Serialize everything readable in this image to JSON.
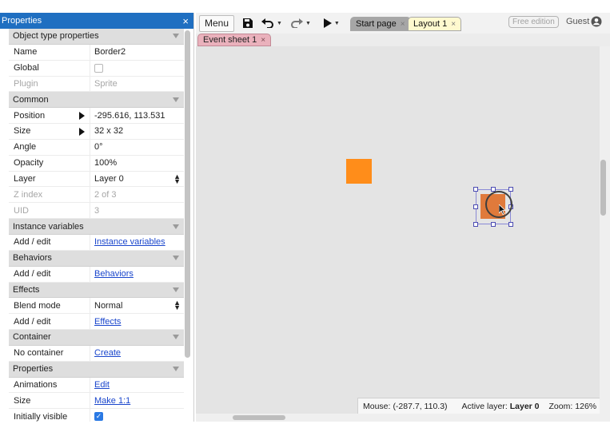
{
  "panel": {
    "title": "Properties",
    "close_glyph": "×",
    "rows": [
      {
        "type": "section",
        "label": "Object type properties"
      },
      {
        "type": "text",
        "label": "Name",
        "value": "Border2"
      },
      {
        "type": "checkbox",
        "label": "Global",
        "checked": false
      },
      {
        "type": "text",
        "label": "Plugin",
        "value": "Sprite",
        "dim": true
      },
      {
        "type": "section",
        "label": "Common"
      },
      {
        "type": "text",
        "label": "Position",
        "value": "-295.616, 113.531",
        "expander": true
      },
      {
        "type": "text",
        "label": "Size",
        "value": "32 x 32",
        "expander": true
      },
      {
        "type": "text",
        "label": "Angle",
        "value": "0°"
      },
      {
        "type": "text",
        "label": "Opacity",
        "value": "100%"
      },
      {
        "type": "select",
        "label": "Layer",
        "value": "Layer 0"
      },
      {
        "type": "text",
        "label": "Z index",
        "value": "2 of 3",
        "dim": true
      },
      {
        "type": "text",
        "label": "UID",
        "value": "3",
        "dim": true
      },
      {
        "type": "section",
        "label": "Instance variables"
      },
      {
        "type": "link",
        "label": "Add / edit",
        "value": "Instance variables"
      },
      {
        "type": "section",
        "label": "Behaviors"
      },
      {
        "type": "link",
        "label": "Add / edit",
        "value": "Behaviors"
      },
      {
        "type": "section",
        "label": "Effects"
      },
      {
        "type": "select",
        "label": "Blend mode",
        "value": "Normal"
      },
      {
        "type": "link",
        "label": "Add / edit",
        "value": "Effects"
      },
      {
        "type": "section",
        "label": "Container"
      },
      {
        "type": "link",
        "label": "No container",
        "value": "Create"
      },
      {
        "type": "section",
        "label": "Properties"
      },
      {
        "type": "link",
        "label": "Animations",
        "value": "Edit"
      },
      {
        "type": "link",
        "label": "Size",
        "value": "Make 1:1"
      },
      {
        "type": "checkbox",
        "label": "Initially visible",
        "checked": true
      }
    ]
  },
  "toolbar": {
    "menu_label": "Menu",
    "tabs": [
      {
        "label": "Start page",
        "active": false
      },
      {
        "label": "Layout 1",
        "active": true
      }
    ],
    "tab_close_glyph": "×",
    "free_badge": "Free edition",
    "user": "Guest"
  },
  "subtabs": {
    "event_sheet": "Event sheet 1"
  },
  "status": {
    "mouse_label": "Mouse:",
    "mouse_value": "(-287.7, 110.3)",
    "layer_label": "Active layer:",
    "layer_value": "Layer 0",
    "zoom_label": "Zoom:",
    "zoom_value": "126%"
  },
  "colors": {
    "panel_title_bg": "#1f6fc1",
    "sprite_a": "#ff8d1a",
    "sprite_b": "#e07a3b",
    "tab_active": "#fff9cf",
    "event_tab": "#eab1bc"
  },
  "icons": [
    "save-icon",
    "undo-icon",
    "redo-icon",
    "play-icon",
    "user-avatar-icon",
    "collapse-triangle-icon",
    "expand-arrow-icon",
    "mouse-cursor-icon"
  ]
}
